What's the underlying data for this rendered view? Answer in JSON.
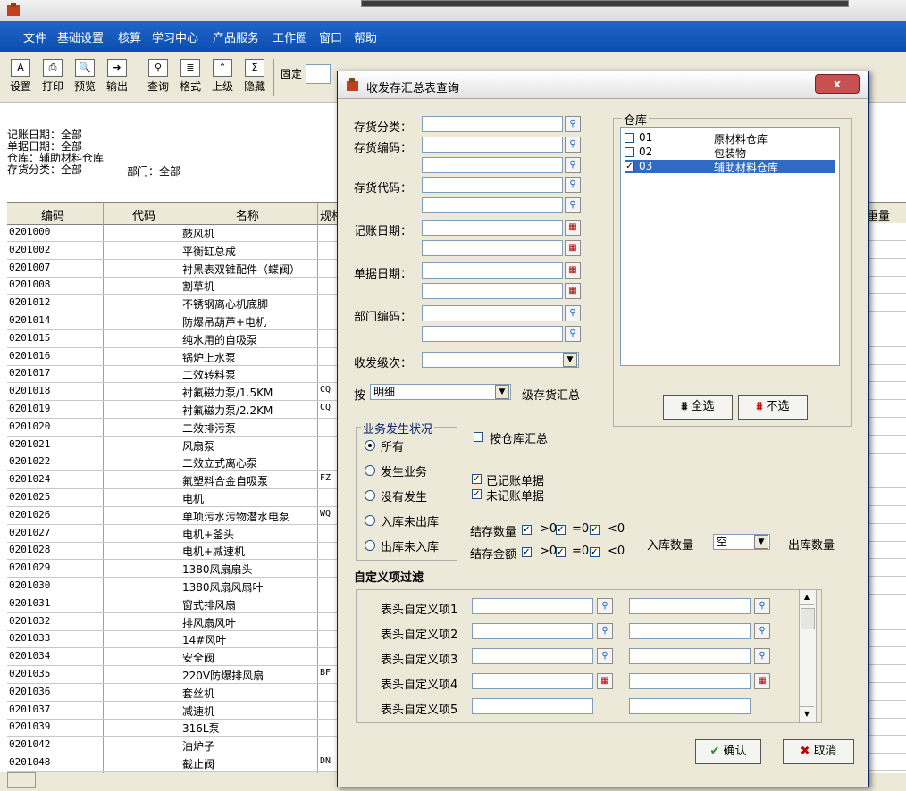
{
  "menu": [
    "文件",
    "基础设置",
    "核算",
    "学习中心",
    "产品服务",
    "工作圈",
    "窗口",
    "帮助"
  ],
  "toolbar": {
    "buttons": [
      {
        "label": "设置",
        "icon": "A"
      },
      {
        "label": "打印",
        "icon": "⎙"
      },
      {
        "label": "预览",
        "icon": "🔍"
      },
      {
        "label": "输出",
        "icon": "➜"
      },
      {
        "label": "查询",
        "icon": "⚲"
      },
      {
        "label": "格式",
        "icon": "≣"
      },
      {
        "label": "上级",
        "icon": "⌃"
      },
      {
        "label": "隐藏",
        "icon": "Σ"
      }
    ],
    "fixed_label": "固定"
  },
  "report": {
    "header_lines": [
      "记账日期：全部",
      "单据日期：全部",
      "仓库：辅助材料仓库",
      "存货分类：全部"
    ],
    "dept": "部门：全部",
    "columns": [
      "编码",
      "代码",
      "名称",
      "规格",
      "重量"
    ],
    "rows": [
      {
        "code": "0201000",
        "name": "鼓风机",
        "spec": ""
      },
      {
        "code": "0201002",
        "name": "平衡缸总成",
        "spec": ""
      },
      {
        "code": "0201007",
        "name": "衬黑表双锥配件（蝶阀）",
        "spec": ""
      },
      {
        "code": "0201008",
        "name": "割草机",
        "spec": ""
      },
      {
        "code": "0201012",
        "name": "不锈钢离心机底脚",
        "spec": ""
      },
      {
        "code": "0201014",
        "name": "防爆吊葫芦+电机",
        "spec": ""
      },
      {
        "code": "0201015",
        "name": "纯水用的自吸泵",
        "spec": ""
      },
      {
        "code": "0201016",
        "name": "锅炉上水泵",
        "spec": ""
      },
      {
        "code": "0201017",
        "name": "二效转料泵",
        "spec": ""
      },
      {
        "code": "0201018",
        "name": "衬氟磁力泵/1.5KM",
        "spec": "CQ"
      },
      {
        "code": "0201019",
        "name": "衬氟磁力泵/2.2KM",
        "spec": "CQ"
      },
      {
        "code": "0201020",
        "name": "二效排污泵",
        "spec": ""
      },
      {
        "code": "0201021",
        "name": "风扇泵",
        "spec": ""
      },
      {
        "code": "0201022",
        "name": "二效立式离心泵",
        "spec": ""
      },
      {
        "code": "0201024",
        "name": "氟塑料合金自吸泵",
        "spec": "FZ"
      },
      {
        "code": "0201025",
        "name": "电机",
        "spec": ""
      },
      {
        "code": "0201026",
        "name": "单项污水污物潜水电泵",
        "spec": "WQ"
      },
      {
        "code": "0201027",
        "name": "电机+釜头",
        "spec": ""
      },
      {
        "code": "0201028",
        "name": "电机+减速机",
        "spec": ""
      },
      {
        "code": "0201029",
        "name": "1380风扇扇头",
        "spec": ""
      },
      {
        "code": "0201030",
        "name": "1380风扇风扇叶",
        "spec": ""
      },
      {
        "code": "0201031",
        "name": "窗式排风扇",
        "spec": ""
      },
      {
        "code": "0201032",
        "name": "排风扇风叶",
        "spec": ""
      },
      {
        "code": "0201033",
        "name": "14#风叶",
        "spec": ""
      },
      {
        "code": "0201034",
        "name": "安全阀",
        "spec": ""
      },
      {
        "code": "0201035",
        "name": "220V防爆排风扇",
        "spec": "BF"
      },
      {
        "code": "0201036",
        "name": "套丝机",
        "spec": ""
      },
      {
        "code": "0201037",
        "name": "减速机",
        "spec": ""
      },
      {
        "code": "0201039",
        "name": "316L泵",
        "spec": ""
      },
      {
        "code": "0201042",
        "name": "油炉子",
        "spec": ""
      },
      {
        "code": "0201048",
        "name": "截止阀",
        "spec": "DN"
      }
    ]
  },
  "dialog": {
    "title": "收发存汇总表查询",
    "close": "x",
    "labels": {
      "inv_class": "存货分类：",
      "inv_code": "存货编码：",
      "inv_daima": "存货代码：",
      "post_date": "记账日期：",
      "doc_date": "单据日期：",
      "dept_code": "部门编码：",
      "level": "收发级次：",
      "by": "按",
      "by_suffix": "级存货汇总",
      "by_value": "明细",
      "warehouse": "仓库"
    },
    "warehouses": [
      {
        "code": "01",
        "name": "原材料仓库",
        "checked": false
      },
      {
        "code": "02",
        "name": "包装物",
        "checked": false
      },
      {
        "code": "03",
        "name": "辅助材料仓库",
        "checked": true
      }
    ],
    "select_all": "全选",
    "select_none": "不选",
    "biz_group": "业务发生状况",
    "radios": [
      "所有",
      "发生业务",
      "没有发生",
      "入库未出库",
      "出库未入库"
    ],
    "by_wh": "按仓库汇总",
    "posted": "已记账单据",
    "unposted": "未记账单据",
    "bal_qty": "结存数量",
    "bal_amt": "结存金额",
    "gt0": ">0",
    "eq0": "=0",
    "lt0": "<0",
    "in_qty": "入库数量",
    "in_qty_value": "空",
    "out_qty": "出库数量",
    "custom_title": "自定义项过滤",
    "custom_items": [
      "表头自定义项1",
      "表头自定义项2",
      "表头自定义项3",
      "表头自定义项4",
      "表头自定义项5"
    ],
    "ok": "确认",
    "cancel": "取消"
  }
}
